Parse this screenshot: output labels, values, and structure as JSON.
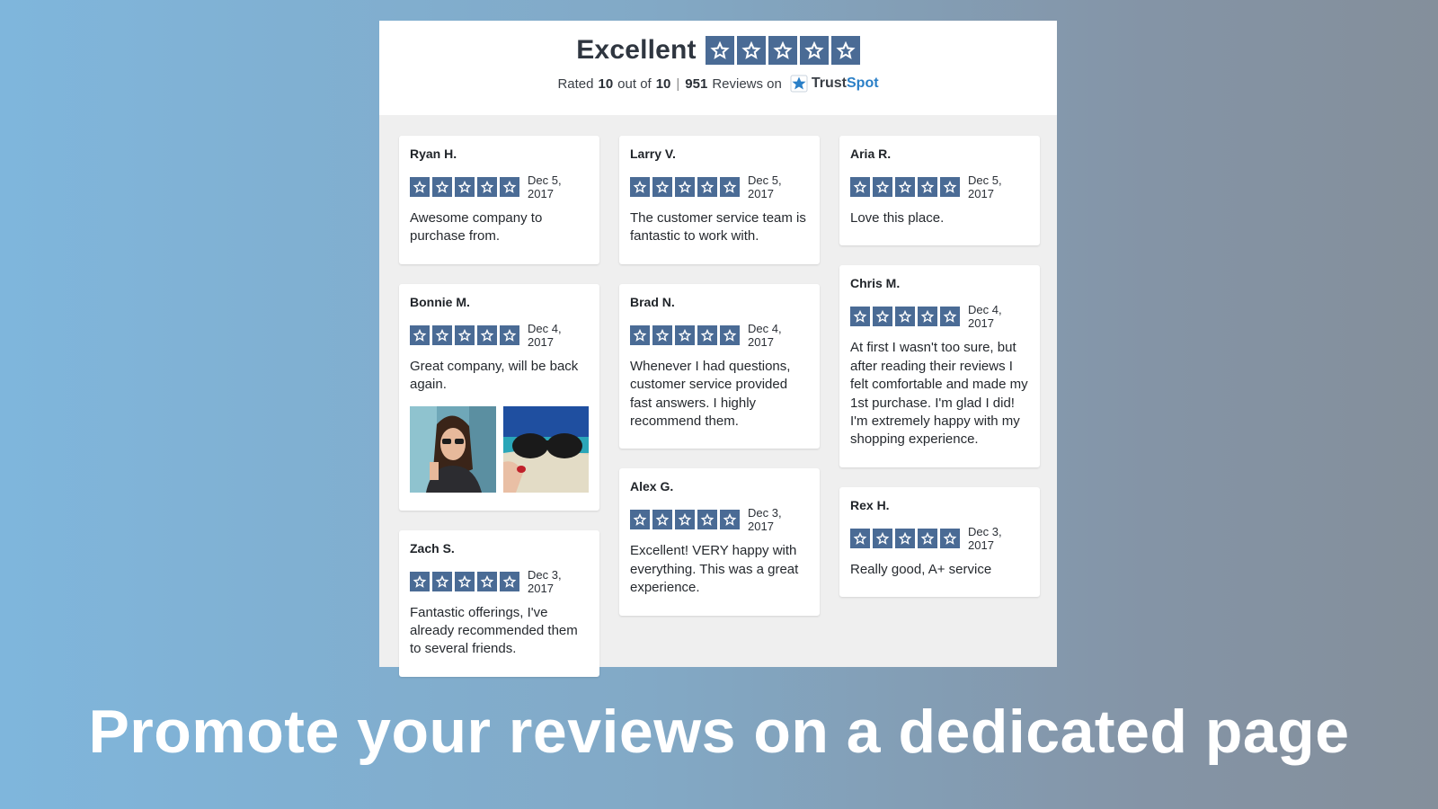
{
  "header": {
    "title": "Excellent",
    "stars": 5,
    "rated_prefix": "Rated",
    "rated_value": "10",
    "rated_middle": "out of",
    "rated_max": "10",
    "separator": "|",
    "review_count": "951",
    "reviews_suffix": "Reviews on",
    "brand_trust": "Trust",
    "brand_spot": "Spot"
  },
  "colors": {
    "star_box": "#4a6b95",
    "brand_blue": "#2a7fc7",
    "background_left": "#7fb6dc",
    "background_right": "#848f9b"
  },
  "columns": [
    [
      {
        "name": "Ryan H.",
        "rating": 5,
        "date": "Dec 5, 2017",
        "text": "Awesome company to purchase from."
      },
      {
        "name": "Bonnie M.",
        "rating": 5,
        "date": "Dec 4, 2017",
        "text": "Great company, will be back again.",
        "photos": [
          "photo-woman-sunglasses",
          "photo-sunglasses-beach"
        ]
      },
      {
        "name": "Zach S.",
        "rating": 5,
        "date": "Dec 3, 2017",
        "text": "Fantastic offerings, I've already recommended them to several friends."
      }
    ],
    [
      {
        "name": "Larry V.",
        "rating": 5,
        "date": "Dec 5, 2017",
        "text": "The customer service team is fantastic to work with."
      },
      {
        "name": "Brad N.",
        "rating": 5,
        "date": "Dec 4, 2017",
        "text": "Whenever I had questions, customer service provided fast answers. I highly recommend them."
      },
      {
        "name": "Alex G.",
        "rating": 5,
        "date": "Dec 3, 2017",
        "text": "Excellent! VERY happy with everything. This was a great experience."
      }
    ],
    [
      {
        "name": "Aria R.",
        "rating": 5,
        "date": "Dec 5, 2017",
        "text": "Love this place."
      },
      {
        "name": "Chris M.",
        "rating": 5,
        "date": "Dec 4, 2017",
        "text": "At first I wasn't too sure, but after reading their reviews I felt comfortable and made my 1st purchase. I'm glad I did! I'm extremely happy with my shopping experience."
      },
      {
        "name": "Rex H.",
        "rating": 5,
        "date": "Dec 3, 2017",
        "text": "Really good, A+ service"
      }
    ]
  ],
  "promo_caption": "Promote your reviews on a dedicated page"
}
